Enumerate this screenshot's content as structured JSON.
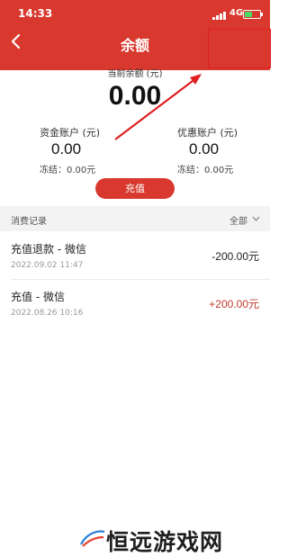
{
  "status_bar": {
    "time": "14:33",
    "network": "4G"
  },
  "header": {
    "title": "余额"
  },
  "balance": {
    "label": "当前余额 (元)",
    "value": "0.00"
  },
  "accounts": [
    {
      "label": "资金账户 (元)",
      "value": "0.00",
      "frozen": "冻结：0.00元"
    },
    {
      "label": "优惠账户 (元)",
      "value": "0.00",
      "frozen": "冻结：0.00元"
    }
  ],
  "recharge_button": "充值",
  "records": {
    "title": "消费记录",
    "filter": "全部",
    "items": [
      {
        "title": "充值退款 - 微信",
        "date": "2022.09.02 11:47",
        "amount": "-200.00元"
      },
      {
        "title": "充值 - 微信",
        "date": "2022.08.26 10:16",
        "amount": "+200.00元"
      }
    ]
  },
  "watermark": "恒远游戏网",
  "colors": {
    "header_red": "#d8382e",
    "positive_amount": "#c0392b",
    "negative_amount": "#222222",
    "annotation_red": "#e02020"
  }
}
